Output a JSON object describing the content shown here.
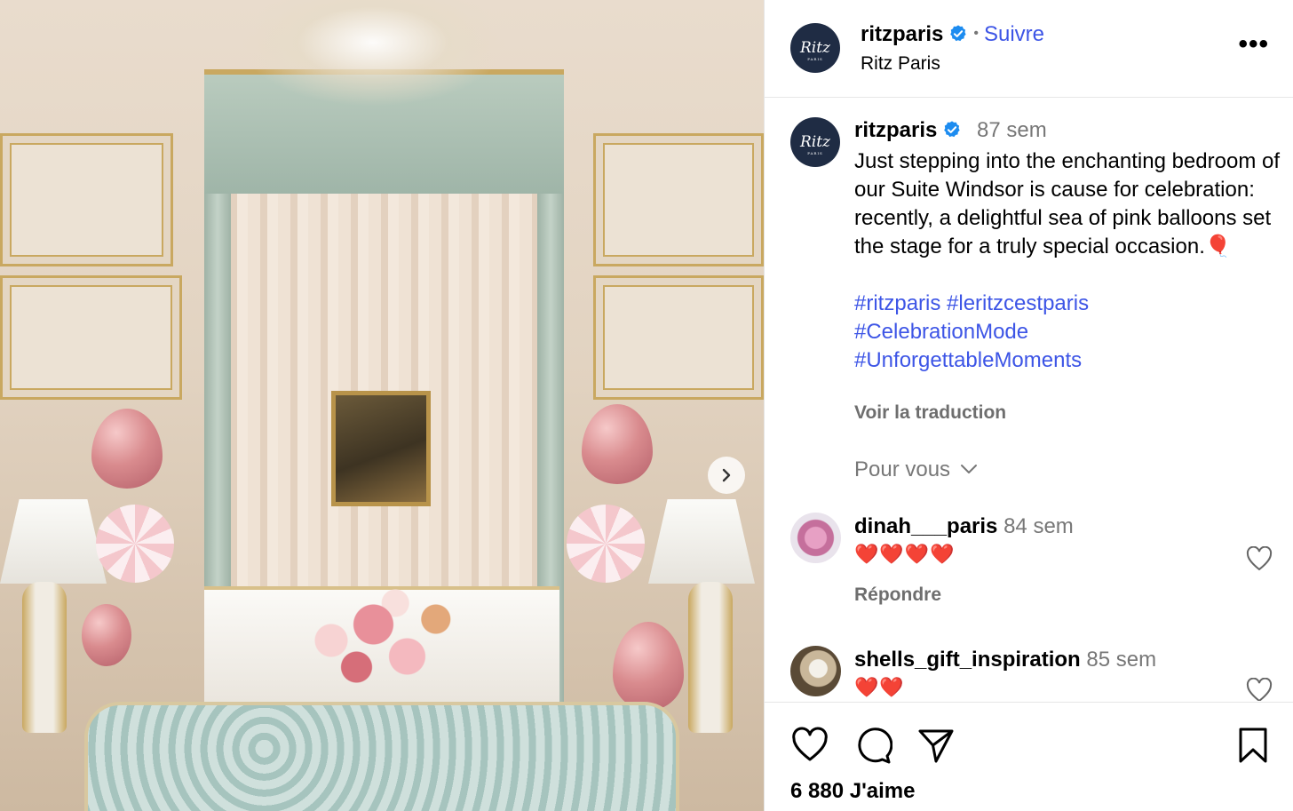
{
  "post": {
    "username": "ritzparis",
    "follow_label": "Suivre",
    "location": "Ritz Paris",
    "avatar_text": "Ritz",
    "avatar_subtext": "PARIS",
    "menu_label": "•••",
    "caption_time": "87 sem",
    "caption": "Just stepping into the enchanting bedroom of our Suite Windsor is cause for celebration: recently, a delightful sea of pink balloons set the stage for a truly special occasion.🎈",
    "hashtags": [
      "#ritzparis #leritzcestparis",
      "#CelebrationMode",
      "#UnforgettableMoments"
    ],
    "translate_label": "Voir la traduction",
    "for_you_label": "Pour vous",
    "likes": "6 880 J'aime"
  },
  "comments": [
    {
      "username": "dinah___paris",
      "time": "84 sem",
      "text": "❤️❤️❤️❤️",
      "reply_label": "Répondre"
    },
    {
      "username": "shells_gift_inspiration",
      "time": "85 sem",
      "text": "❤️❤️"
    }
  ],
  "colors": {
    "link_blue": "#3d55e6",
    "verified_blue": "#1d8cf0",
    "muted_gray": "#737373",
    "avatar_navy": "#1f2c44"
  },
  "icons": [
    "verified-badge-icon",
    "more-options-icon",
    "chevron-right-icon",
    "chevron-down-icon",
    "heart-icon",
    "comment-icon",
    "share-icon",
    "bookmark-icon"
  ]
}
